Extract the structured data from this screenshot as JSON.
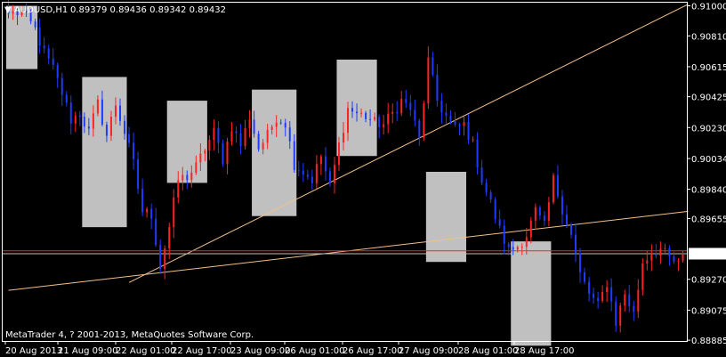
{
  "header": {
    "dropdown_glyph": "▼",
    "symbol_timeframe": "AUDUSD,H1",
    "ohlc": "0.89379 0.89436 0.89342 0.89432"
  },
  "copyright": "MetaTrader 4, ? 2001-2013, MetaQuotes Software Corp.",
  "colors": {
    "background": "#000000",
    "frame": "#ffffff",
    "bull": "#ff2222",
    "bear": "#1f3bff",
    "box": "#c0c0c0",
    "trendline": "#f2c08a",
    "price_line": "#ff2222",
    "price_label_bg": "#ffffff",
    "price_label_text": "#000000"
  },
  "chart_data": {
    "type": "candlestick",
    "symbol": "AUDUSD",
    "timeframe": "H1",
    "y_ticks": [
      0.91,
      0.9081,
      0.90615,
      0.90425,
      0.9023,
      0.90034,
      0.8984,
      0.89655,
      0.8927,
      0.89075,
      0.88885
    ],
    "y_tick_labels": [
      "0.91000",
      "0.90810",
      "0.90615",
      "0.90425",
      "0.90230",
      "0.90034",
      "0.89840",
      "0.89655",
      "0.89270",
      "0.89075",
      "0.88885"
    ],
    "ylim": [
      0.8888,
      0.9102
    ],
    "x_labels": [
      "20 Aug 2013",
      "21 Aug 09:00",
      "22 Aug 01:00",
      "22 Aug 17:00",
      "23 Aug 09:00",
      "26 Aug 01:00",
      "26 Aug 17:00",
      "27 Aug 09:00",
      "28 Aug 01:00",
      "28 Aug 17:00"
    ],
    "current_price": 0.89432,
    "current_price_label": "0.89432",
    "reference_line": 0.8945,
    "bar_count": 152,
    "anchors": [
      [
        0,
        0.9095
      ],
      [
        3,
        0.9096
      ],
      [
        6,
        0.9085
      ],
      [
        8,
        0.907
      ],
      [
        10,
        0.906
      ],
      [
        12,
        0.9045
      ],
      [
        14,
        0.9028
      ],
      [
        16,
        0.9032
      ],
      [
        18,
        0.902
      ],
      [
        20,
        0.9038
      ],
      [
        22,
        0.9018
      ],
      [
        24,
        0.9038
      ],
      [
        26,
        0.902
      ],
      [
        28,
        0.9
      ],
      [
        30,
        0.897
      ],
      [
        32,
        0.8968
      ],
      [
        34,
        0.8935
      ],
      [
        36,
        0.896
      ],
      [
        38,
        0.899
      ],
      [
        40,
        0.8992
      ],
      [
        42,
        0.8998
      ],
      [
        44,
        0.901
      ],
      [
        46,
        0.902
      ],
      [
        48,
        0.9003
      ],
      [
        50,
        0.9024
      ],
      [
        52,
        0.9012
      ],
      [
        54,
        0.903
      ],
      [
        56,
        0.901
      ],
      [
        58,
        0.9018
      ],
      [
        60,
        0.903
      ],
      [
        62,
        0.9026
      ],
      [
        64,
        0.9
      ],
      [
        66,
        0.8995
      ],
      [
        68,
        0.899
      ],
      [
        70,
        0.9005
      ],
      [
        72,
        0.8985
      ],
      [
        74,
        0.9012
      ],
      [
        76,
        0.9035
      ],
      [
        78,
        0.9032
      ],
      [
        80,
        0.903
      ],
      [
        82,
        0.9026
      ],
      [
        84,
        0.9025
      ],
      [
        86,
        0.9032
      ],
      [
        88,
        0.904
      ],
      [
        90,
        0.9035
      ],
      [
        92,
        0.9015
      ],
      [
        94,
        0.9065
      ],
      [
        96,
        0.904
      ],
      [
        98,
        0.903
      ],
      [
        100,
        0.9022
      ],
      [
        102,
        0.9025
      ],
      [
        104,
        0.9012
      ],
      [
        106,
        0.899
      ],
      [
        108,
        0.8975
      ],
      [
        110,
        0.8958
      ],
      [
        112,
        0.8945
      ],
      [
        114,
        0.8948
      ],
      [
        116,
        0.8955
      ],
      [
        118,
        0.897
      ],
      [
        120,
        0.896
      ],
      [
        122,
        0.899
      ],
      [
        124,
        0.8972
      ],
      [
        126,
        0.8955
      ],
      [
        128,
        0.893
      ],
      [
        130,
        0.8918
      ],
      [
        132,
        0.891
      ],
      [
        134,
        0.8925
      ],
      [
        136,
        0.89
      ],
      [
        138,
        0.8918
      ],
      [
        140,
        0.8905
      ],
      [
        142,
        0.8938
      ],
      [
        144,
        0.8944
      ],
      [
        146,
        0.8946
      ],
      [
        148,
        0.894
      ],
      [
        150,
        0.8936
      ],
      [
        151,
        0.89432
      ]
    ],
    "boxes": [
      {
        "from_bar": 0,
        "to_bar": 6,
        "high": 0.91,
        "low": 0.906
      },
      {
        "from_bar": 17,
        "to_bar": 26,
        "high": 0.9055,
        "low": 0.896
      },
      {
        "from_bar": 36,
        "to_bar": 44,
        "high": 0.904,
        "low": 0.8988
      },
      {
        "from_bar": 55,
        "to_bar": 64,
        "high": 0.9047,
        "low": 0.8967
      },
      {
        "from_bar": 74,
        "to_bar": 82,
        "high": 0.9066,
        "low": 0.9005
      },
      {
        "from_bar": 94,
        "to_bar": 102,
        "high": 0.8995,
        "low": 0.8938
      },
      {
        "from_bar": 113,
        "to_bar": 121,
        "high": 0.8951,
        "low": 0.8885
      }
    ],
    "trendlines": [
      {
        "from": [
          27,
          0.8925
        ],
        "to": [
          151,
          0.9101
        ]
      },
      {
        "from": [
          0,
          0.892
        ],
        "to": [
          151,
          0.897
        ]
      }
    ]
  }
}
